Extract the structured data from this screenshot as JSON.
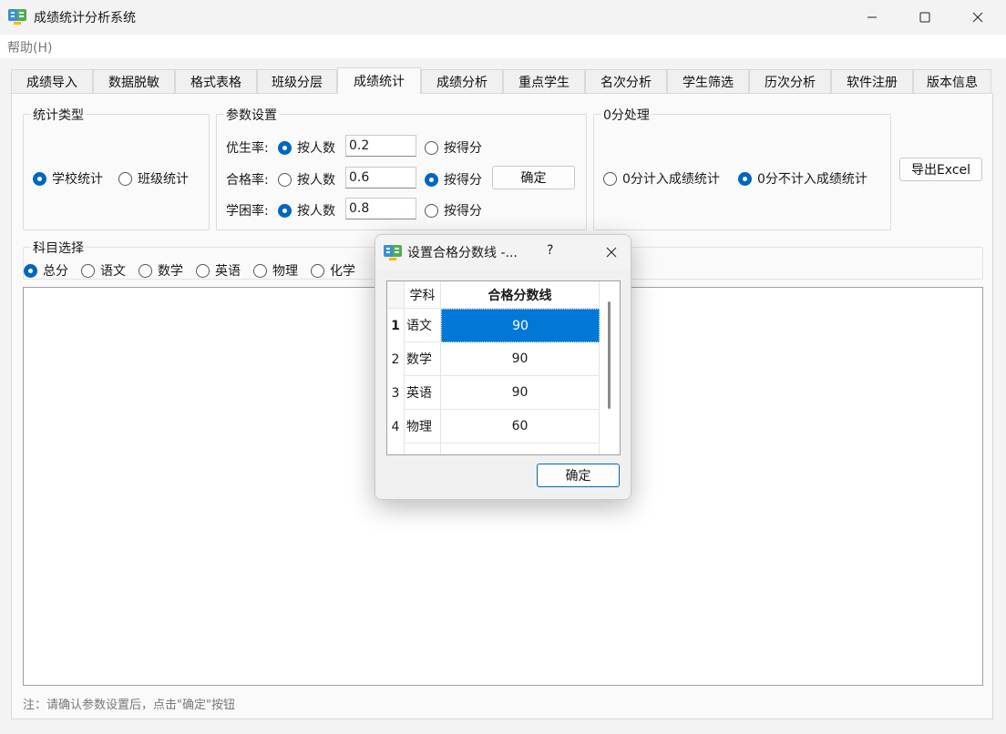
{
  "window": {
    "title": "成绩统计分析系统"
  },
  "menu": {
    "help": "帮助(H)"
  },
  "tabs": [
    {
      "label": "成绩导入"
    },
    {
      "label": "数据脱敏"
    },
    {
      "label": "格式表格"
    },
    {
      "label": "班级分层"
    },
    {
      "label": "成绩统计"
    },
    {
      "label": "成绩分析"
    },
    {
      "label": "重点学生"
    },
    {
      "label": "名次分析"
    },
    {
      "label": "学生筛选"
    },
    {
      "label": "历次分析"
    },
    {
      "label": "软件注册"
    },
    {
      "label": "版本信息"
    }
  ],
  "active_tab": "成绩统计",
  "stat_type": {
    "title": "统计类型",
    "options": [
      {
        "label": "学校统计",
        "selected": true
      },
      {
        "label": "班级统计",
        "selected": false
      }
    ]
  },
  "params": {
    "title": "参数设置",
    "rows": [
      {
        "label": "优生率:",
        "by_count": "按人数",
        "value": "0.2",
        "by_score": "按得分",
        "count_selected": true,
        "score_selected": false
      },
      {
        "label": "合格率:",
        "by_count": "按人数",
        "value": "0.6",
        "by_score": "按得分",
        "count_selected": false,
        "score_selected": true
      },
      {
        "label": "学困率:",
        "by_count": "按人数",
        "value": "0.8",
        "by_score": "按得分",
        "count_selected": true,
        "score_selected": false
      }
    ],
    "confirm_label": "确定"
  },
  "zero_handling": {
    "title": "0分处理",
    "options": [
      {
        "label": "0分计入成绩统计",
        "selected": false
      },
      {
        "label": "0分不计入成绩统计",
        "selected": true
      }
    ]
  },
  "export_label": "导出Excel",
  "subjects": {
    "title": "科目选择",
    "options": [
      {
        "label": "总分",
        "selected": true
      },
      {
        "label": "语文",
        "selected": false
      },
      {
        "label": "数学",
        "selected": false
      },
      {
        "label": "英语",
        "selected": false
      },
      {
        "label": "物理",
        "selected": false
      },
      {
        "label": "化学",
        "selected": false
      }
    ]
  },
  "footnote": "注：请确认参数设置后，点击\"确定\"按钮",
  "dialog": {
    "title": "设置合格分数线 -...",
    "help": "?",
    "columns": [
      "学科",
      "合格分数线"
    ],
    "rows": [
      {
        "num": "1",
        "subject": "语文",
        "score": "90",
        "selected": true
      },
      {
        "num": "2",
        "subject": "数学",
        "score": "90",
        "selected": false
      },
      {
        "num": "3",
        "subject": "英语",
        "score": "90",
        "selected": false
      },
      {
        "num": "4",
        "subject": "物理",
        "score": "60",
        "selected": false
      }
    ],
    "ok_label": "确定"
  },
  "colors": {
    "accent": "#0067c0",
    "selection": "#0078d7"
  }
}
